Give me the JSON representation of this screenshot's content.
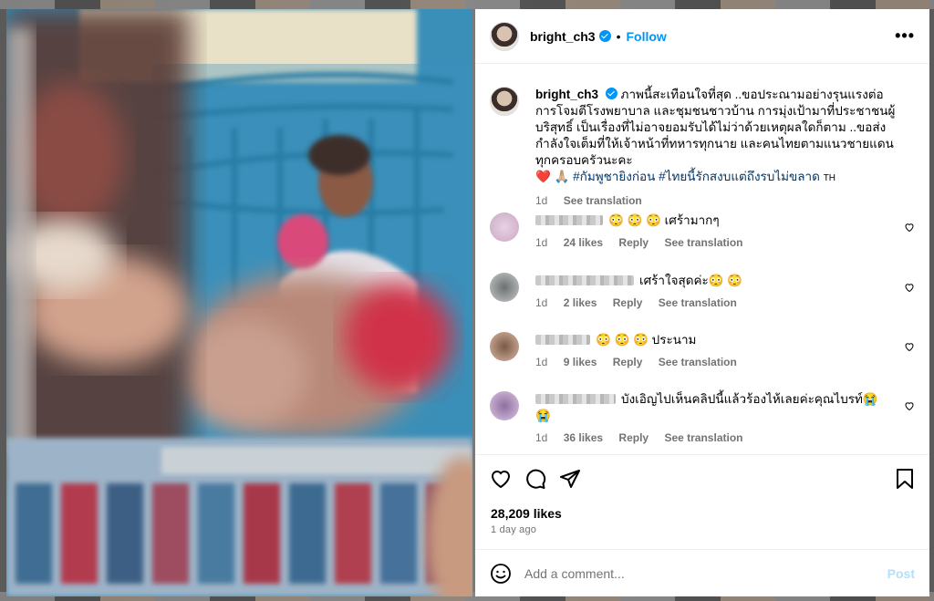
{
  "post": {
    "username": "bright_ch3",
    "follow_label": "Follow",
    "dot": "•",
    "more_label": "•••"
  },
  "caption": {
    "username": "bright_ch3",
    "text": "ภาพนี้สะเทือนใจที่สุด ..ขอประณามอย่างรุนแรงต่อการโจมตีโรงพยาบาล และชุมชนชาวบ้าน การมุ่งเป้ามาที่ประชาชนผู้บริสุทธิ์ เป็นเรื่องที่ไม่อาจยอมรับได้ไม่ว่าด้วยเหตุผลใดก็ตาม ..ขอส่งกำลังใจเต็มที่ให้เจ้าหน้าที่ทหารทุกนาย และคนไทยตามแนวชายแดนทุกครอบครัวนะคะ",
    "emojis": "❤️ 🙏🏼",
    "hashtag1": "#กัมพูชายิงก่อน",
    "hashtag2": "#ไทยนี้รักสงบแต่ถึงรบไม่ขลาด",
    "lang": "TH",
    "time": "1d",
    "see_translation": "See translation"
  },
  "comments": [
    {
      "text": "😳 😳 😳 เศร้ามากๆ",
      "time": "1d",
      "likes": "24 likes",
      "reply": "Reply",
      "see_translation": "See translation",
      "avatar_color": "#d9b8d4"
    },
    {
      "text": "เศร้าใจสุดค่ะ😳 😳",
      "time": "1d",
      "likes": "2 likes",
      "reply": "Reply",
      "see_translation": "See translation",
      "avatar_color": "#9aa0a0"
    },
    {
      "text": "😳 😳 😳 ประนาม",
      "time": "1d",
      "likes": "9 likes",
      "reply": "Reply",
      "see_translation": "See translation",
      "avatar_color": "#b58a70"
    },
    {
      "text": "บังเอิญไปเห็นคลิปนี้แล้วร้องไห้เลยค่ะคุณไบรท์😭😭",
      "time": "1d",
      "likes": "36 likes",
      "reply": "Reply",
      "see_translation": "See translation",
      "avatar_color": "#b99ac2"
    }
  ],
  "footer": {
    "likes": "28,209 likes",
    "ago": "1 day ago",
    "comment_placeholder": "Add a comment...",
    "post_label": "Post"
  },
  "colors": {
    "accent": "#0095f6",
    "post_disabled": "#b2dffc",
    "muted": "#737373"
  }
}
